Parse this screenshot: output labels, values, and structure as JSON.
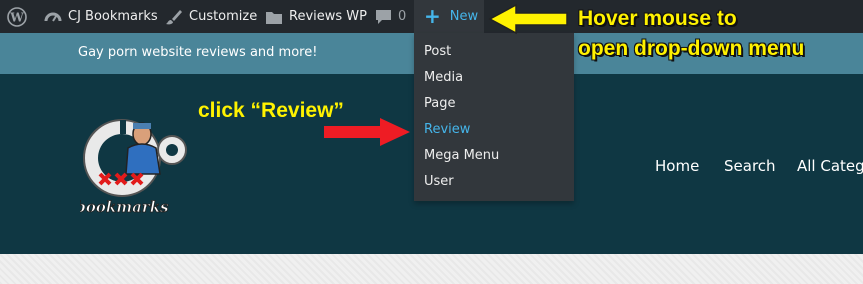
{
  "admin_bar": {
    "site_name": "CJ Bookmarks",
    "customize_label": "Customize",
    "reviews_label": "Reviews WP",
    "comments_count": "0",
    "new_label": "New",
    "icons": [
      "wordpress-icon",
      "dashboard-icon",
      "brush-icon",
      "folder-icon",
      "comment-icon",
      "plus-icon"
    ]
  },
  "site": {
    "tagline": "Gay porn website reviews and more!",
    "logo_text": "bookmarks"
  },
  "new_menu": {
    "items": [
      "Post",
      "Media",
      "Page",
      "Review",
      "Mega Menu",
      "User"
    ],
    "active": "Review"
  },
  "nav": {
    "items": [
      "Home",
      "Search",
      "All Catego"
    ]
  },
  "annotations": {
    "hover_line1": "Hover mouse to",
    "hover_line2": "open drop-down menu",
    "click_note": "click “Review”"
  },
  "colors": {
    "admin_bar": "#23282d",
    "tagline_bar": "#4a8599",
    "header": "#0f3743",
    "accent": "#45b5ea",
    "annotation_yellow": "#fff200",
    "arrow_red": "#ee1c24"
  }
}
